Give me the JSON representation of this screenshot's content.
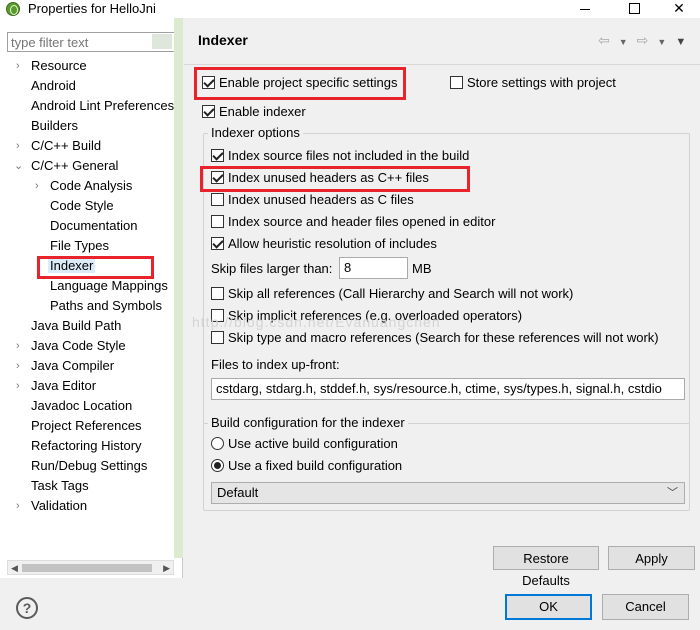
{
  "window": {
    "title": "Properties for HelloJni"
  },
  "filter": {
    "placeholder": "type filter text"
  },
  "tree": {
    "items": [
      {
        "label": "Resource"
      },
      {
        "label": "Android"
      },
      {
        "label": "Android Lint Preferences"
      },
      {
        "label": "Builders"
      },
      {
        "label": "C/C++ Build"
      },
      {
        "label": "C/C++ General"
      },
      {
        "label": "Code Analysis"
      },
      {
        "label": "Code Style"
      },
      {
        "label": "Documentation"
      },
      {
        "label": "File Types"
      },
      {
        "label": "Indexer"
      },
      {
        "label": "Language Mappings"
      },
      {
        "label": "Paths and Symbols"
      },
      {
        "label": "Java Build Path"
      },
      {
        "label": "Java Code Style"
      },
      {
        "label": "Java Compiler"
      },
      {
        "label": "Java Editor"
      },
      {
        "label": "Javadoc Location"
      },
      {
        "label": "Project References"
      },
      {
        "label": "Refactoring History"
      },
      {
        "label": "Run/Debug Settings"
      },
      {
        "label": "Task Tags"
      },
      {
        "label": "Validation"
      }
    ]
  },
  "page": {
    "title": "Indexer",
    "enable_project_specific": {
      "label": "Enable project specific settings",
      "checked": true
    },
    "store_with_project": {
      "label": "Store settings with project",
      "checked": false
    },
    "enable_indexer": {
      "label": "Enable indexer",
      "checked": true
    },
    "indexer_options": {
      "title": "Indexer options",
      "options": [
        {
          "label": "Index source files not included in the build",
          "checked": true
        },
        {
          "label": "Index unused headers as C++ files",
          "checked": true
        },
        {
          "label": "Index unused headers as C files",
          "checked": false
        },
        {
          "label": "Index source and header files opened in editor",
          "checked": false
        },
        {
          "label": "Allow heuristic resolution of includes",
          "checked": true
        }
      ],
      "skip_larger_label": "Skip files larger than:",
      "skip_larger_value": "8",
      "skip_larger_unit": "MB",
      "skip_options": [
        {
          "label": "Skip all references (Call Hierarchy and Search will not work)",
          "checked": false
        },
        {
          "label": "Skip implicit references (e.g. overloaded operators)",
          "checked": false
        },
        {
          "label": "Skip type and macro references (Search for these references will not work)",
          "checked": false
        }
      ],
      "files_upfront_label": "Files to index up-front:",
      "files_upfront_value": "cstdarg, stdarg.h, stddef.h, sys/resource.h, ctime, sys/types.h, signal.h, cstdio"
    },
    "build_config": {
      "title": "Build configuration for the indexer",
      "active": {
        "label": "Use active build configuration",
        "selected": false
      },
      "fixed": {
        "label": "Use a fixed build configuration",
        "selected": true
      },
      "dropdown_value": "Default"
    },
    "restore_defaults": "Restore Defaults",
    "apply": "Apply"
  },
  "footer": {
    "ok": "OK",
    "cancel": "Cancel",
    "help": "?"
  },
  "watermark": "http://blog.csdn.net/Evanuangchen",
  "colors": {
    "highlight_box": "#e8232c",
    "selection": "#dcebf8"
  }
}
